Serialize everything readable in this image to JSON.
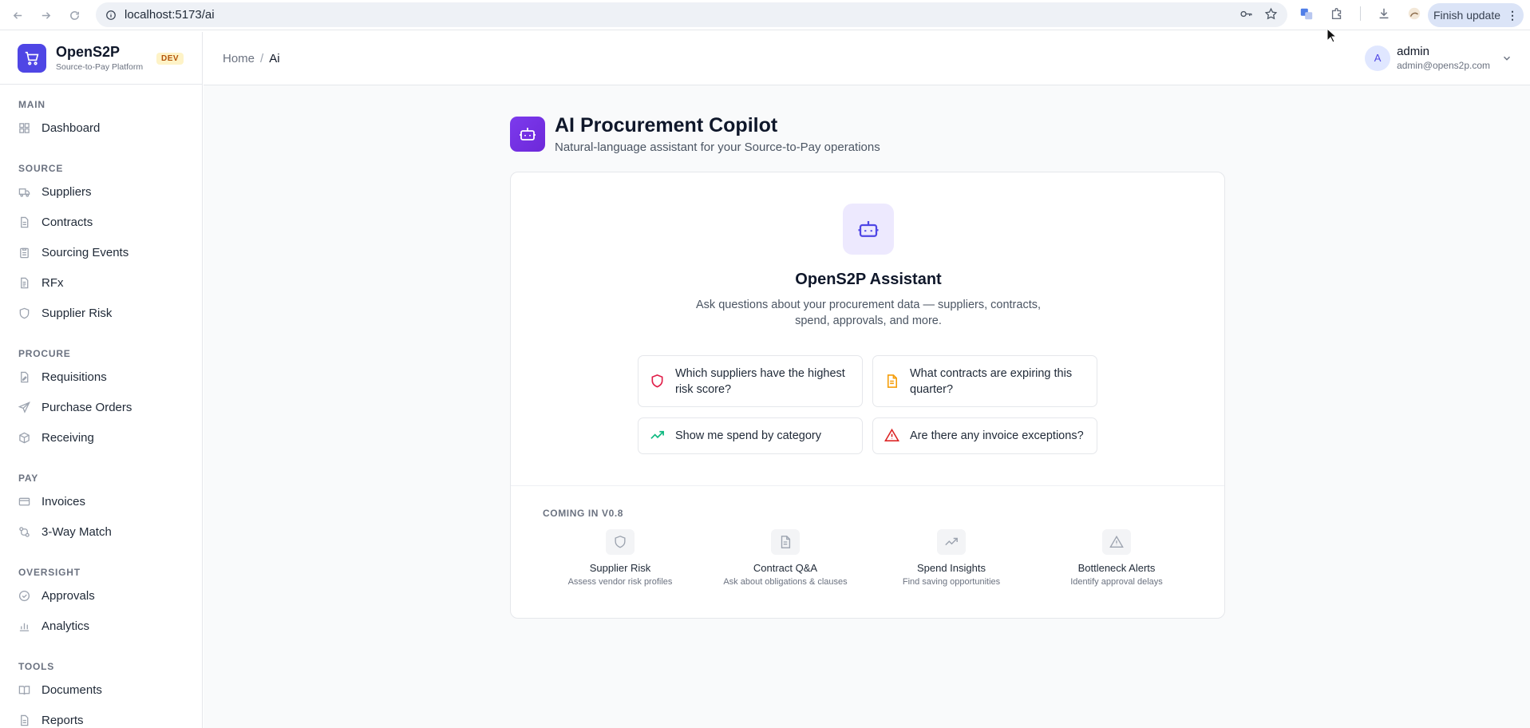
{
  "browser": {
    "url": "localhost:5173/ai",
    "finish_update": "Finish update"
  },
  "brand": {
    "name": "OpenS2P",
    "subtitle": "Source-to-Pay Platform",
    "badge": "DEV"
  },
  "sidebar": {
    "sections": {
      "main": "MAIN",
      "source": "SOURCE",
      "procure": "PROCURE",
      "pay": "PAY",
      "oversight": "OVERSIGHT",
      "tools": "TOOLS"
    },
    "items": {
      "dashboard": "Dashboard",
      "suppliers": "Suppliers",
      "contracts": "Contracts",
      "sourcing_events": "Sourcing Events",
      "rfx": "RFx",
      "supplier_risk": "Supplier Risk",
      "requisitions": "Requisitions",
      "purchase_orders": "Purchase Orders",
      "receiving": "Receiving",
      "invoices": "Invoices",
      "three_way_match": "3-Way Match",
      "approvals": "Approvals",
      "analytics": "Analytics",
      "documents": "Documents",
      "reports": "Reports"
    }
  },
  "header": {
    "breadcrumb": [
      "Home",
      "/",
      "Ai"
    ],
    "user": {
      "initial": "A",
      "name": "admin",
      "email": "admin@opens2p.com"
    }
  },
  "page": {
    "title": "AI Procurement Copilot",
    "subtitle": "Natural-language assistant for your Source-to-Pay operations"
  },
  "assistant": {
    "title": "OpenS2P Assistant",
    "description": "Ask questions about your procurement data — suppliers, contracts, spend, approvals, and more.",
    "prompts": [
      "Which suppliers have the highest risk score?",
      "What contracts are expiring this quarter?",
      "Show me spend by category",
      "Are there any invoice exceptions?"
    ]
  },
  "coming_soon": {
    "label": "COMING IN V0.8",
    "features": [
      {
        "name": "Supplier Risk",
        "desc": "Assess vendor risk profiles"
      },
      {
        "name": "Contract Q&A",
        "desc": "Ask about obligations & clauses"
      },
      {
        "name": "Spend Insights",
        "desc": "Find saving opportunities"
      },
      {
        "name": "Bottleneck Alerts",
        "desc": "Identify approval delays"
      }
    ]
  },
  "colors": {
    "accent": "#4f46e5",
    "risk_icon": "#e11d48",
    "doc_icon": "#f59e0b",
    "trend_icon": "#10b981",
    "alert_icon": "#dc2626"
  }
}
